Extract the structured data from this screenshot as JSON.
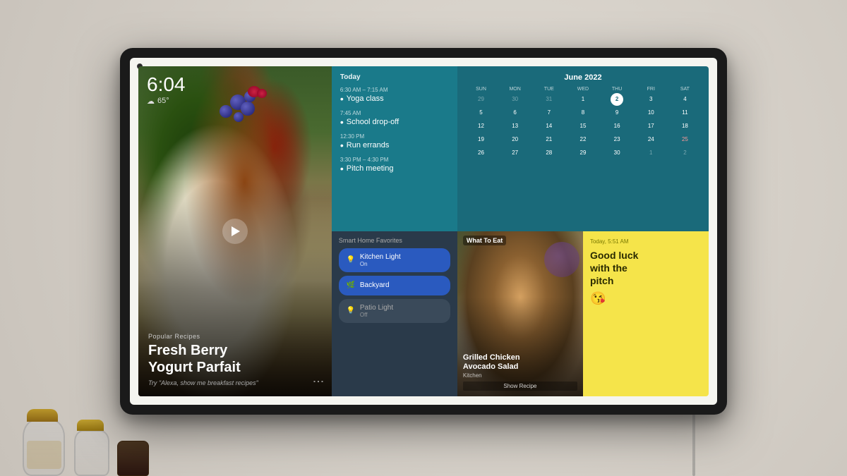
{
  "device": {
    "time": "6:04",
    "weather": "65°",
    "weather_icon": "☁"
  },
  "recipe": {
    "category": "Popular Recipes",
    "title": "Fresh Berry\nYogurt Parfait",
    "hint": "Try \"Alexa, show me breakfast recipes\""
  },
  "agenda": {
    "day_label": "Today",
    "items": [
      {
        "time": "6:30 AM – 7:15 AM",
        "event": "Yoga class"
      },
      {
        "time": "7:45 AM",
        "event": "School drop-off"
      },
      {
        "time": "12:30 PM",
        "event": "Run errands"
      },
      {
        "time": "3:30 PM – 4:30 PM",
        "event": "Pitch meeting"
      }
    ]
  },
  "calendar": {
    "month": "June 2022",
    "headers": [
      "SUN",
      "MON",
      "TUE",
      "WED",
      "THU",
      "FRI",
      "SAT"
    ],
    "rows": [
      [
        "29",
        "30",
        "31",
        "1",
        "2",
        "3",
        "4"
      ],
      [
        "5",
        "6",
        "7",
        "8",
        "9",
        "10",
        "11"
      ],
      [
        "12",
        "13",
        "14",
        "15",
        "16",
        "17",
        "18"
      ],
      [
        "19",
        "20",
        "21",
        "22",
        "23",
        "24",
        "25"
      ],
      [
        "26",
        "27",
        "28",
        "29",
        "30",
        "1",
        "2"
      ]
    ],
    "current_day": "2",
    "current_row": 0,
    "current_col": 4
  },
  "smart_home": {
    "title": "Smart Home Favorites",
    "items": [
      {
        "name": "Kitchen Light",
        "status": "On",
        "active": true,
        "icon": "💡"
      },
      {
        "name": "Backyard",
        "status": "",
        "active": true,
        "icon": "🌿"
      },
      {
        "name": "Patio Light",
        "status": "Off",
        "active": false,
        "icon": "💡"
      }
    ]
  },
  "food_rec": {
    "section": "What To Eat",
    "name": "Grilled Chicken\nAvocado Salad",
    "source": "Kitchen",
    "cta": "Show Recipe"
  },
  "note": {
    "timestamp": "Today, 5:51 AM",
    "text": "Good luck\nwith the\npitch",
    "emoji": "😘"
  }
}
